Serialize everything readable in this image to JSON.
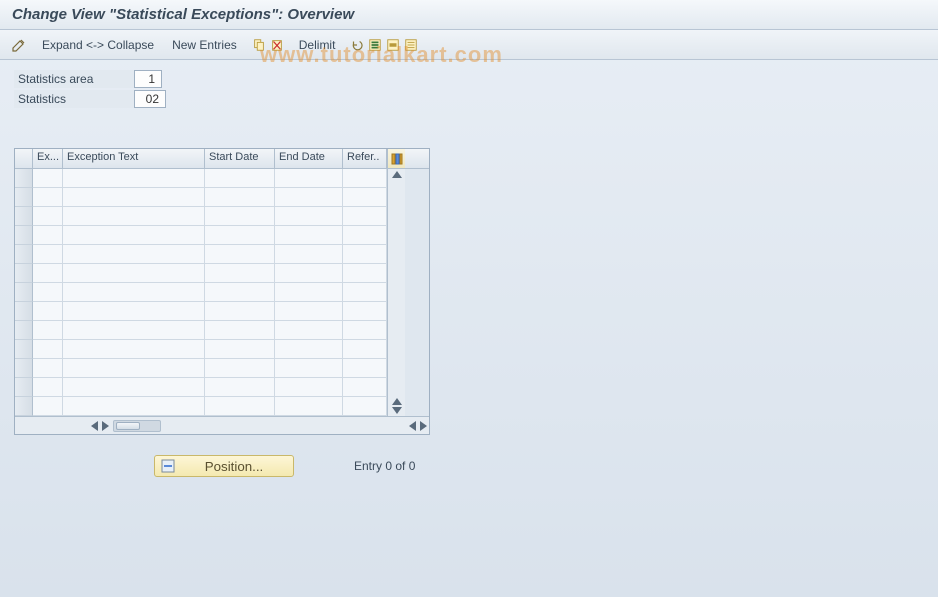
{
  "title": "Change View \"Statistical Exceptions\": Overview",
  "toolbar": {
    "expand_collapse": "Expand <-> Collapse",
    "new_entries": "New Entries",
    "delimit": "Delimit"
  },
  "form": {
    "stats_area_label": "Statistics area",
    "stats_area_value": "1",
    "statistics_label": "Statistics",
    "statistics_value": "02"
  },
  "grid": {
    "columns": {
      "ex": "Ex...",
      "exception_text": "Exception Text",
      "start_date": "Start Date",
      "end_date": "End Date",
      "reference": "Refer.."
    },
    "row_count": 13
  },
  "position_button": "Position...",
  "status": "Entry 0 of 0",
  "watermark": "www.tutorialkart.com"
}
